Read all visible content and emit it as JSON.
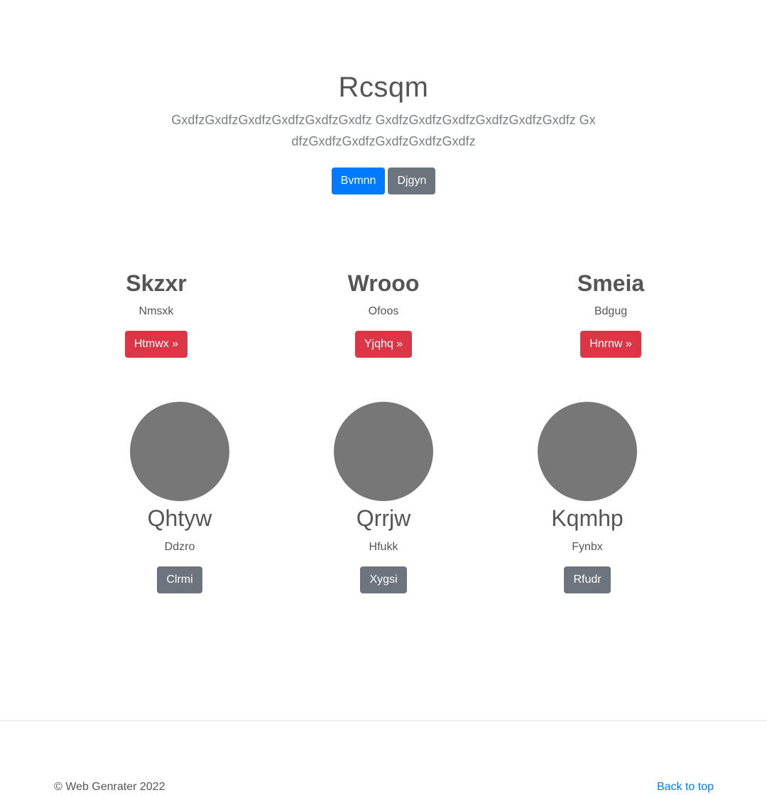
{
  "hero": {
    "title": "Rcsqm",
    "lead": "GxdfzGxdfzGxdfzGxdfzGxdfzGxdfz GxdfzGxdfzGxdfzGxdfzGxdfzGxdfz GxdfzGxdfzGxdfzGxdfzGxdfzGxdfz",
    "primary_button": "Bvmnn",
    "secondary_button": "Djgyn"
  },
  "features": [
    {
      "title": "Skzxr",
      "text": "Nmsxk",
      "button": "Htmwx »"
    },
    {
      "title": "Wrooo",
      "text": "Ofoos",
      "button": "Yjqhq »"
    },
    {
      "title": "Smeia",
      "text": "Bdgug",
      "button": "Hnrnw »"
    }
  ],
  "cards": [
    {
      "title": "Qhtyw",
      "text": "Ddzro",
      "button": "Clrmi"
    },
    {
      "title": "Qrrjw",
      "text": "Hfukk",
      "button": "Xygsi"
    },
    {
      "title": "Kqmhp",
      "text": "Fynbx",
      "button": "Rfudr"
    }
  ],
  "footer": {
    "copyright": "© Web Genrater 2022",
    "back_to_top": "Back to top"
  },
  "colors": {
    "primary": "#007bff",
    "secondary": "#6c757d",
    "danger": "#dc3545",
    "avatar": "#777777"
  }
}
